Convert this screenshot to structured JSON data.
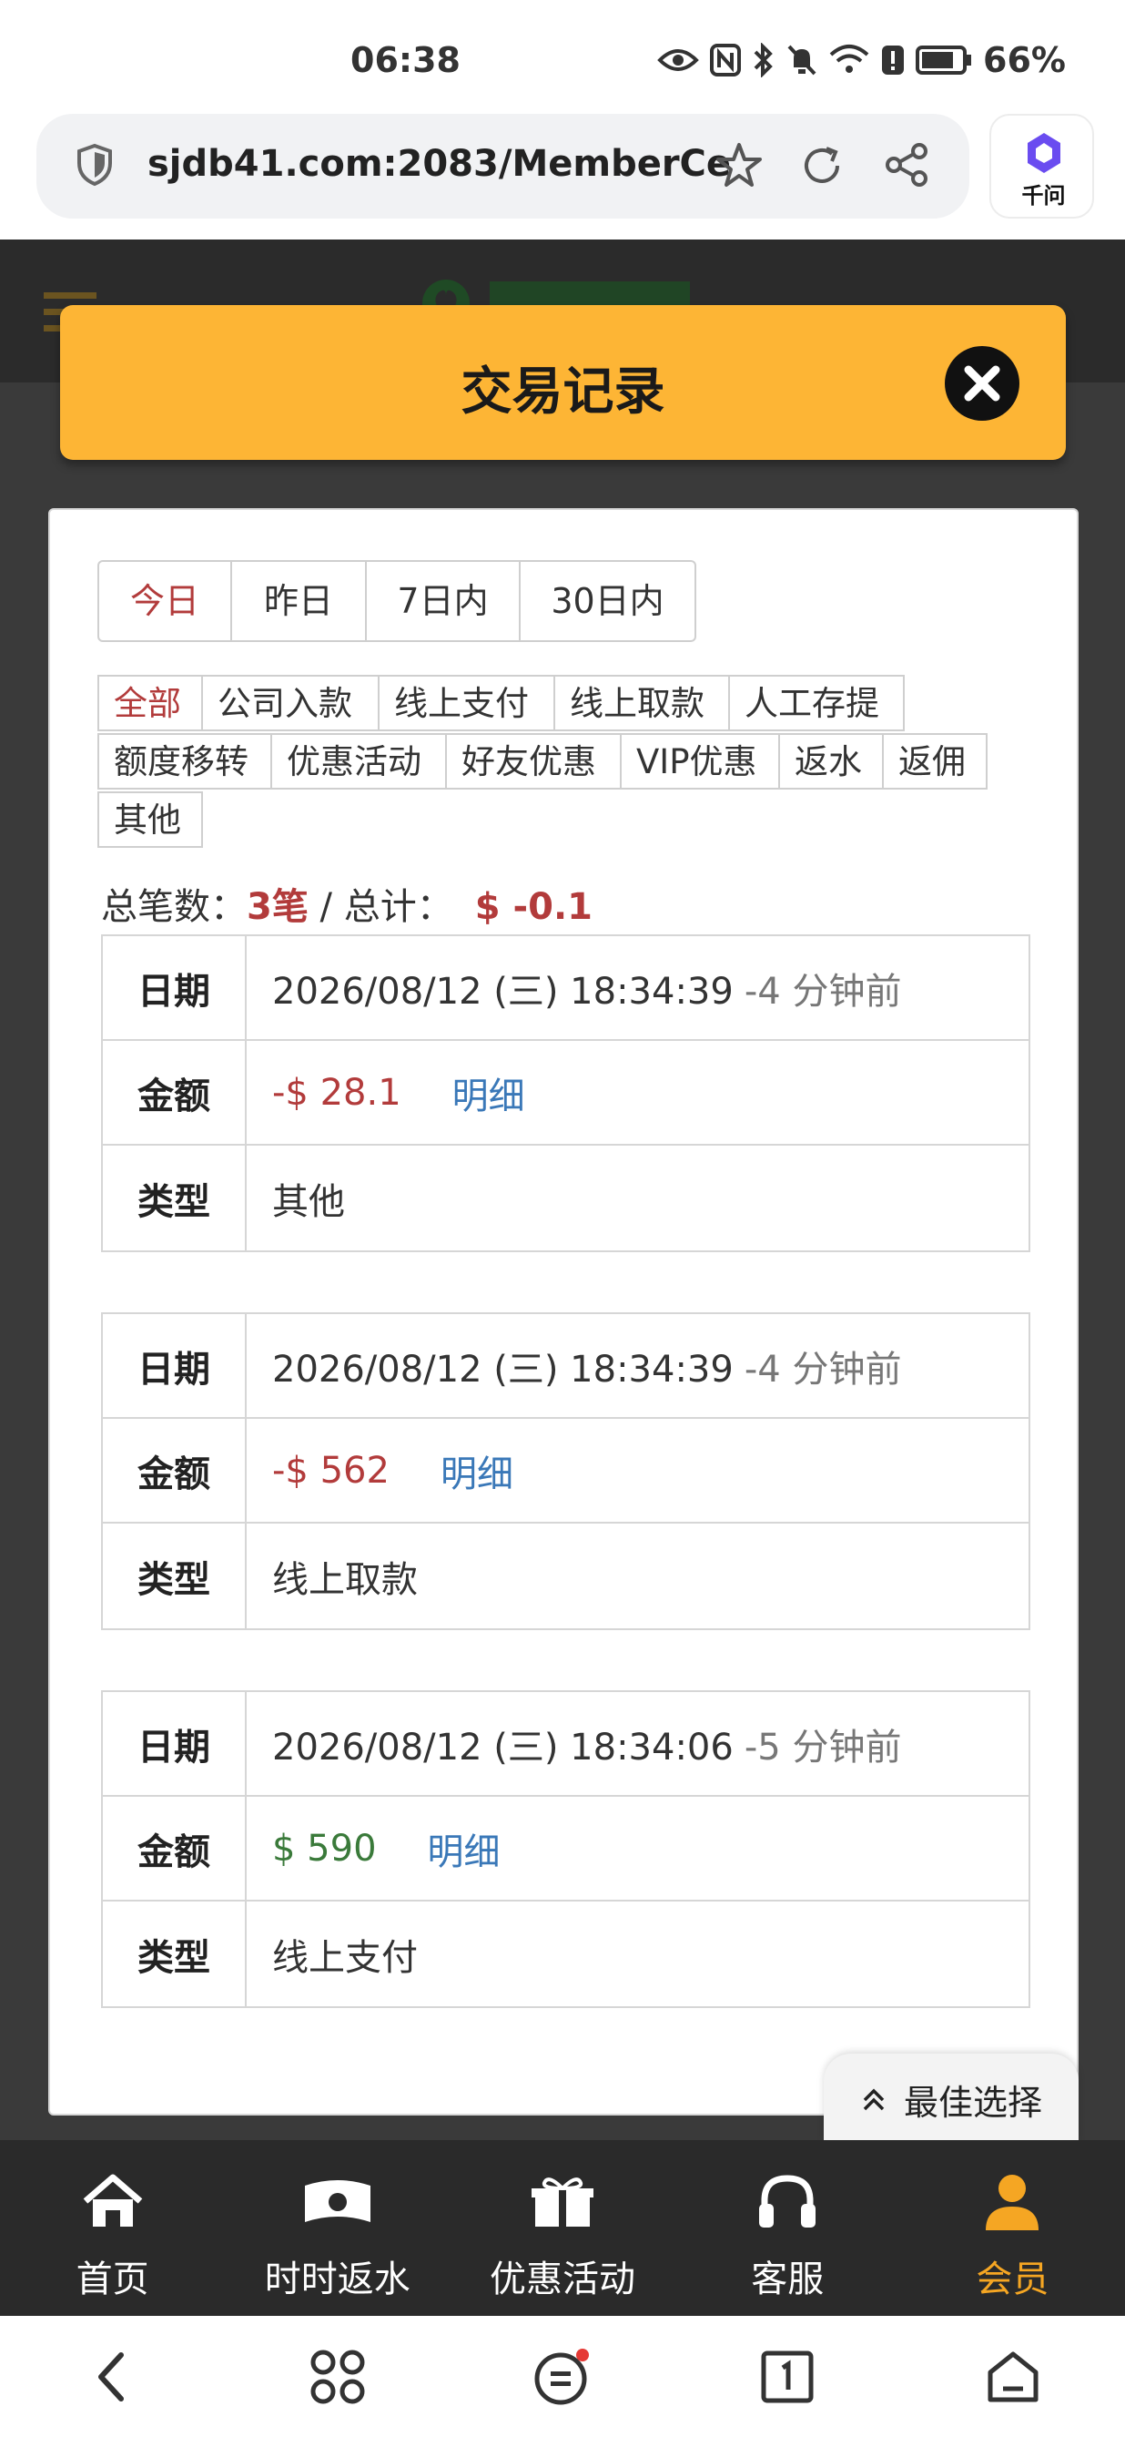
{
  "status_bar": {
    "time": "06:38",
    "battery": "66%",
    "icons": [
      "eye-icon",
      "nfc-icon",
      "bluetooth-icon",
      "mute-icon",
      "wifi-icon",
      "alert-icon",
      "battery-icon"
    ]
  },
  "browser": {
    "url": "sjdb41.com:2083/MemberCe",
    "assistant_label": "千问"
  },
  "modal": {
    "title": "交易记录",
    "accent_color": "#fdb535"
  },
  "date_tabs": [
    {
      "label": "今日",
      "active": true
    },
    {
      "label": "昨日",
      "active": false
    },
    {
      "label": "7日内",
      "active": false
    },
    {
      "label": "30日内",
      "active": false
    }
  ],
  "type_tags": [
    {
      "label": "全部",
      "active": true
    },
    {
      "label": "公司入款",
      "active": false
    },
    {
      "label": "线上支付",
      "active": false
    },
    {
      "label": "线上取款",
      "active": false
    },
    {
      "label": "人工存提",
      "active": false
    },
    {
      "label": "额度移转",
      "active": false
    },
    {
      "label": "优惠活动",
      "active": false
    },
    {
      "label": "好友优惠",
      "active": false
    },
    {
      "label": "VIP优惠",
      "active": false
    },
    {
      "label": "返水",
      "active": false
    },
    {
      "label": "返佣",
      "active": false
    },
    {
      "label": "其他",
      "active": false
    }
  ],
  "summary": {
    "count_label": "总笔数：",
    "count_value": "3笔",
    "separator": " / ",
    "total_label": "总计：",
    "total_value": "$ -0.1"
  },
  "record_labels": {
    "date": "日期",
    "amount": "金额",
    "type": "类型"
  },
  "records": [
    {
      "datetime": "2026/08/12 (三) 18:34:39",
      "ago": "-4 分钟前",
      "amount": "-$ 28.1",
      "detail": "明细",
      "type": "其他",
      "direction": "negative"
    },
    {
      "datetime": "2026/08/12 (三) 18:34:39",
      "ago": "-4 分钟前",
      "amount": "-$ 562",
      "detail": "明细",
      "type": "线上取款",
      "direction": "negative"
    },
    {
      "datetime": "2026/08/12 (三) 18:34:06",
      "ago": "-5 分钟前",
      "amount": "$ 590",
      "detail": "明细",
      "type": "线上支付",
      "direction": "positive"
    }
  ],
  "best_choice": "最佳选择",
  "bottom_nav": [
    {
      "label": "首页",
      "icon": "home-icon",
      "active": false
    },
    {
      "label": "时时返水",
      "icon": "money-icon",
      "active": false
    },
    {
      "label": "优惠活动",
      "icon": "gift-icon",
      "active": false
    },
    {
      "label": "客服",
      "icon": "headset-icon",
      "active": false
    },
    {
      "label": "会员",
      "icon": "user-icon",
      "active": true
    }
  ],
  "colors": {
    "negative": "#b23b3b",
    "positive": "#3a7a3a",
    "link": "#3a78b8",
    "nav_active": "#f5a623"
  }
}
